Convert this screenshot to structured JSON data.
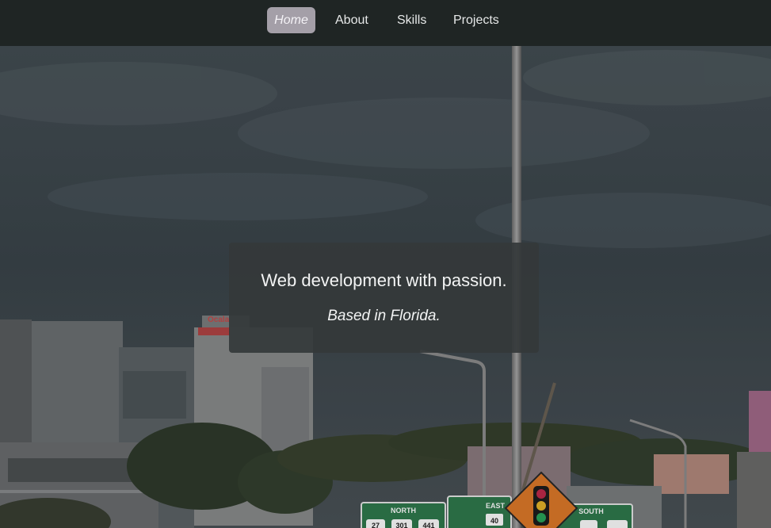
{
  "nav": {
    "items": [
      {
        "label": "Home",
        "active": true
      },
      {
        "label": "About",
        "active": false
      },
      {
        "label": "Skills",
        "active": false
      },
      {
        "label": "Projects",
        "active": false
      }
    ]
  },
  "hero": {
    "tagline": "Web development with passion.",
    "location": "Based in Florida.",
    "signs": {
      "north_heading": "NORTH",
      "north_shields": [
        "27",
        "301",
        "441"
      ],
      "east_heading": "EAST",
      "east_shield": "40",
      "south_heading": "SOUTH"
    },
    "rooftop_sign": "Ocala"
  },
  "colors": {
    "nav_background": "#1f2524",
    "active_pill": "#a49fa8",
    "caption_card": "#34383a",
    "sign_green": "#2f7a4d",
    "traffic_sign_orange": "#e07a2a"
  }
}
